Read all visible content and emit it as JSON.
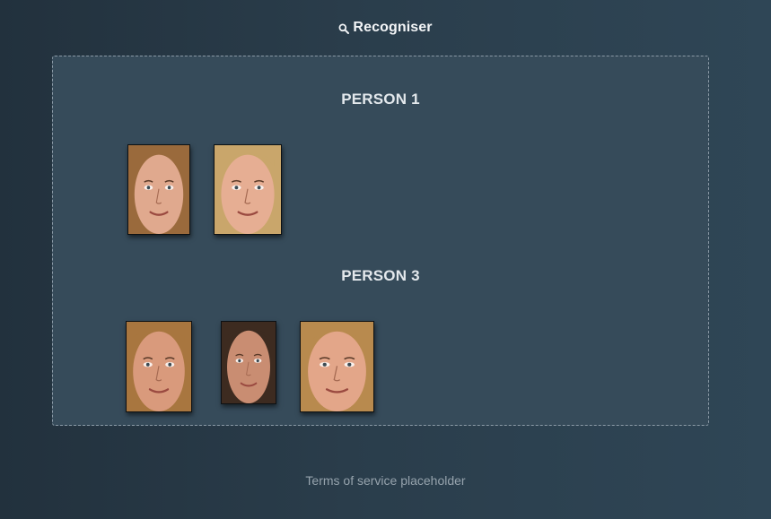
{
  "header": {
    "icon": "search-icon",
    "title": "Recogniser"
  },
  "groups": [
    {
      "title": "PERSON 1",
      "faces": [
        {
          "icon": "face-photo",
          "hair": "#9a6a3c",
          "skin": "#e0a98e"
        },
        {
          "icon": "face-photo",
          "hair": "#c9a66b",
          "skin": "#e6ae93"
        }
      ]
    },
    {
      "title": "PERSON 3",
      "faces": [
        {
          "icon": "face-photo",
          "hair": "#a8763f",
          "skin": "#d99a7c"
        },
        {
          "icon": "face-photo",
          "hair": "#3d2b20",
          "skin": "#c98d72"
        },
        {
          "icon": "face-photo",
          "hair": "#b88a4e",
          "skin": "#e3a689"
        }
      ]
    }
  ],
  "footer": {
    "text": "Terms of service placeholder"
  },
  "colors": {
    "panel_bg": "#364b5a",
    "panel_border": "#8b9aa6",
    "text_light": "#e3e8ec",
    "footer_text": "#96a3ad"
  }
}
